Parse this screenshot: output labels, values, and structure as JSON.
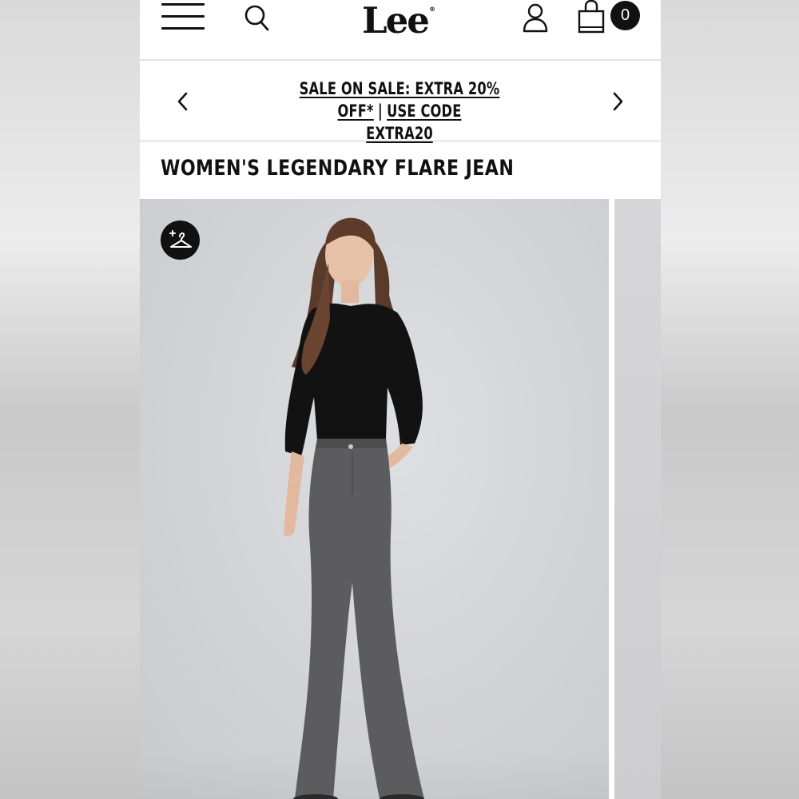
{
  "header": {
    "logo_text": "Lee",
    "logo_mark": "®",
    "cart_count": "0",
    "icons": [
      "hamburger-menu-icon",
      "search-icon",
      "account-icon",
      "shopping-bag-icon"
    ]
  },
  "promo": {
    "line_1": "SALE ON SALE: EXTRA 20% OFF*",
    "separator": "|",
    "line_2": "USE CODE",
    "line_3": "EXTRA20"
  },
  "product": {
    "title": "WOMEN'S LEGENDARY FLARE JEAN"
  },
  "gallery": {
    "wishlist_icon": "add-to-wishlist-hanger-icon"
  },
  "colors": {
    "brand": "#111111",
    "background": "#ffffff",
    "image_backdrop": "#d3d4d7"
  }
}
